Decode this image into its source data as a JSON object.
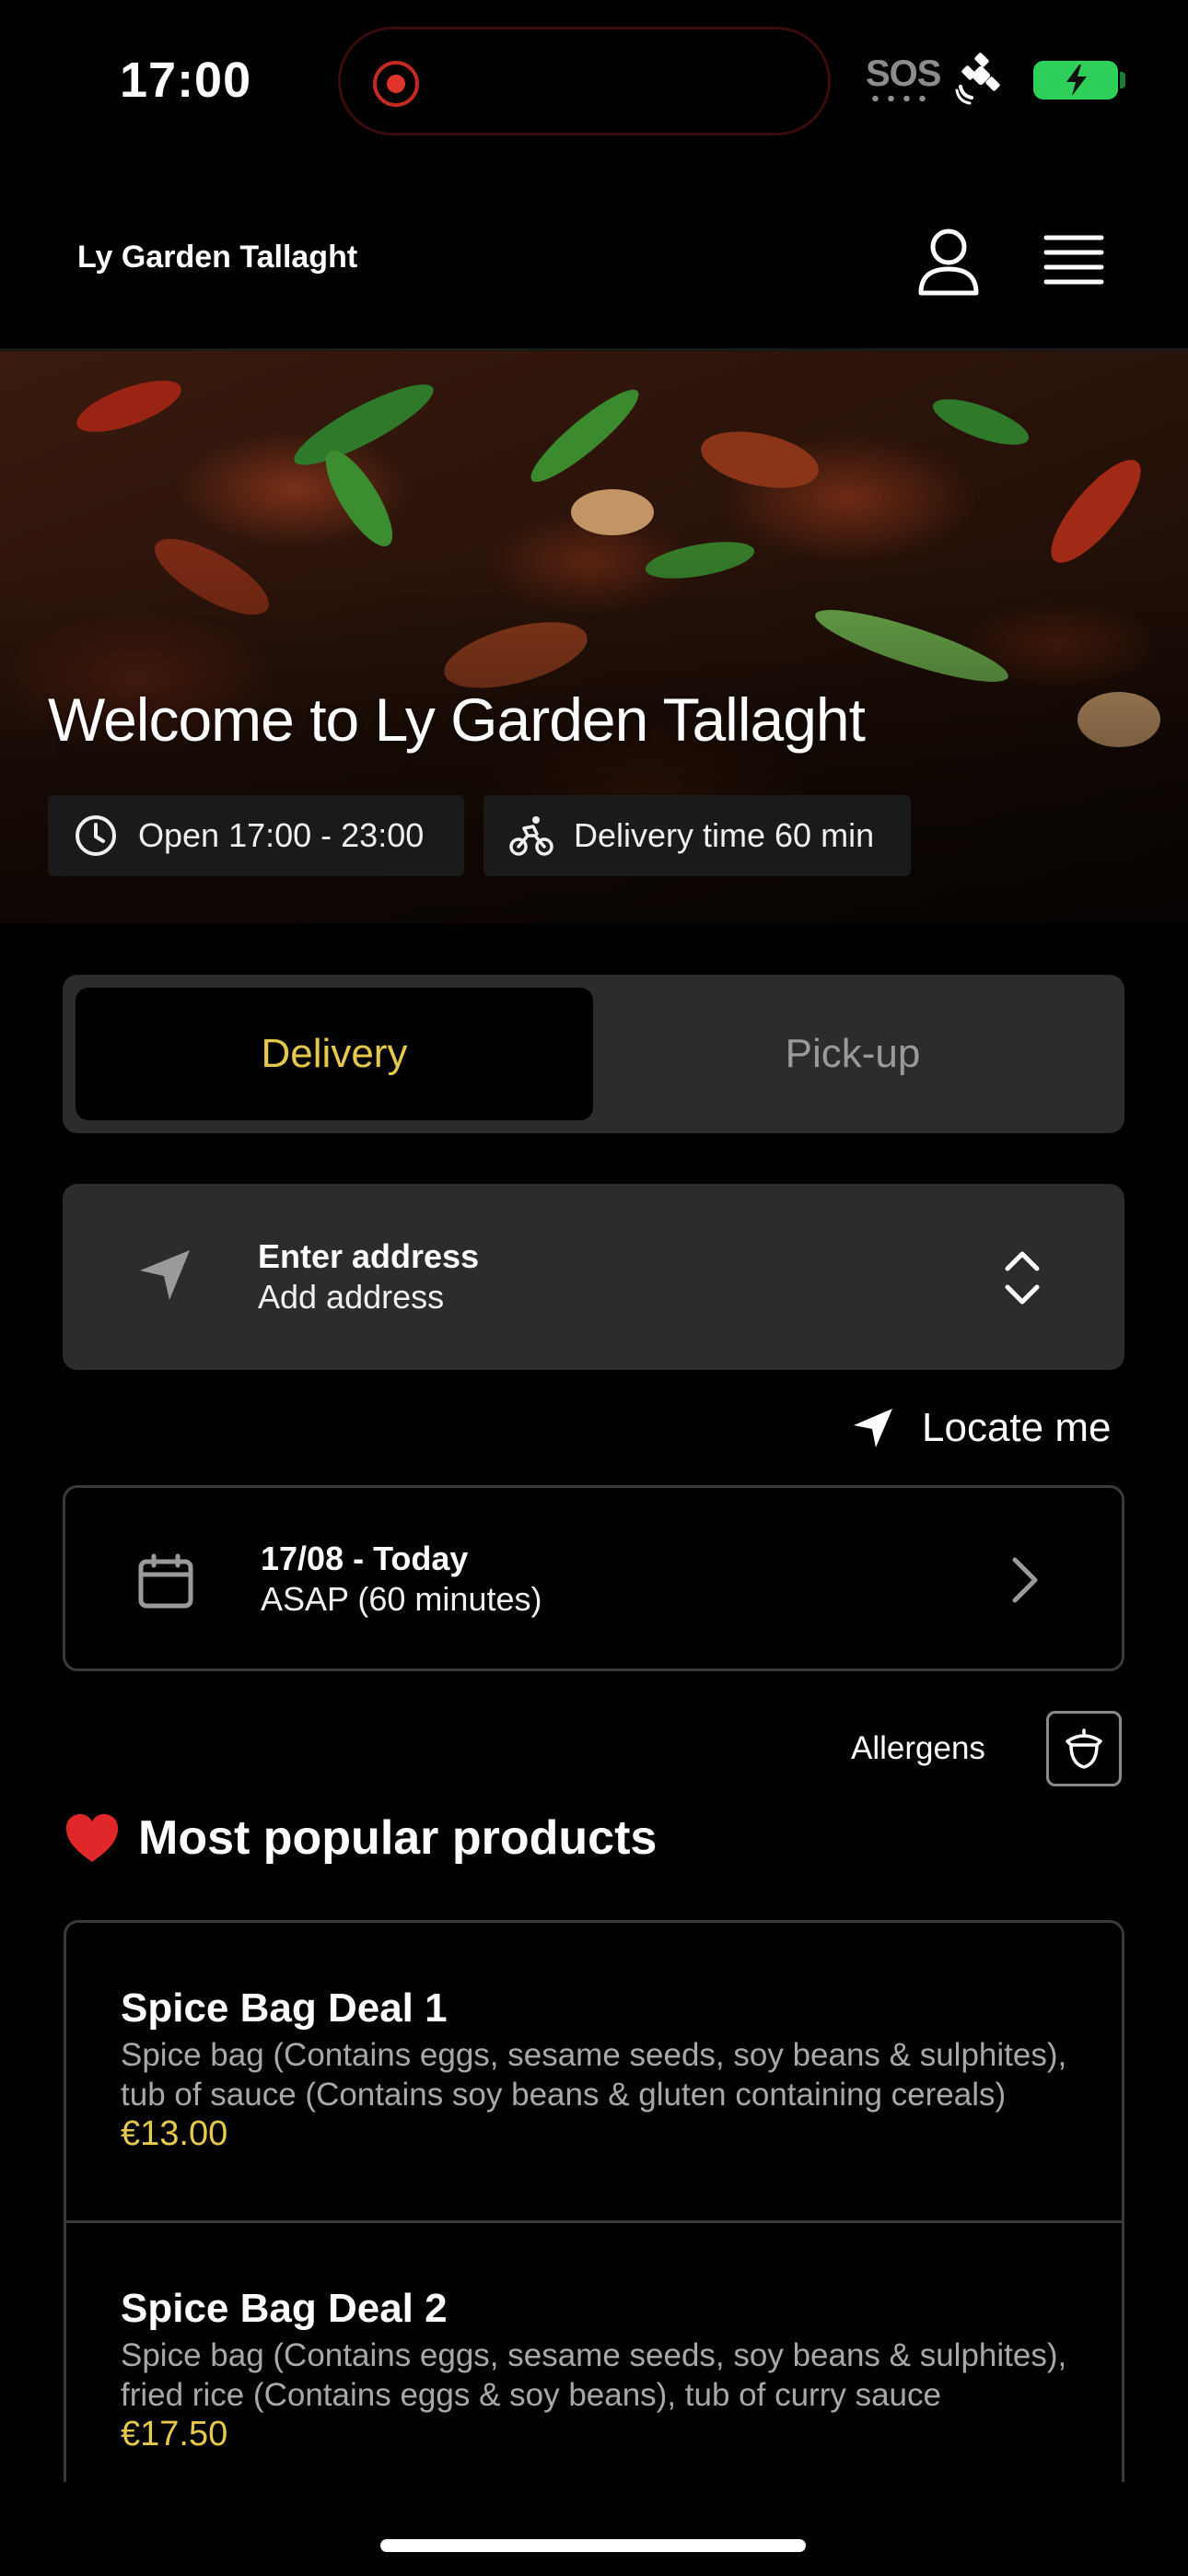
{
  "status_bar": {
    "time": "17:00",
    "sos": "SOS"
  },
  "header": {
    "brand": "Ly Garden Tallaght",
    "icons": [
      "user-icon",
      "hamburger-menu-icon"
    ]
  },
  "hero": {
    "title": "Welcome to Ly Garden Tallaght",
    "open_hours": "Open 17:00 - 23:00",
    "delivery_time": "Delivery time 60 min"
  },
  "order_mode": {
    "options": [
      "Delivery",
      "Pick-up"
    ],
    "selected": "Delivery"
  },
  "address": {
    "title": "Enter address",
    "subtitle": "Add address"
  },
  "locate_me": "Locate me",
  "schedule": {
    "date": "17/08 - Today",
    "time": "ASAP (60 minutes)"
  },
  "allergens_label": "Allergens",
  "popular": {
    "heading": "Most popular products",
    "products": [
      {
        "name": "Spice Bag Deal 1",
        "description": "Spice bag (Contains eggs, sesame seeds, soy beans & sulphites), tub of sauce (Contains soy beans & gluten containing cereals)",
        "price": "€13.00"
      },
      {
        "name": "Spice Bag Deal 2",
        "description": "Spice bag (Contains eggs, sesame seeds, soy beans & sulphites), fried rice (Contains eggs & soy beans), tub of curry sauce",
        "price": "€17.50"
      }
    ]
  },
  "colors": {
    "accent": "#e5c94d",
    "card": "#2c2c2c",
    "battery": "#2fd05a",
    "recording": "#e0332a"
  }
}
